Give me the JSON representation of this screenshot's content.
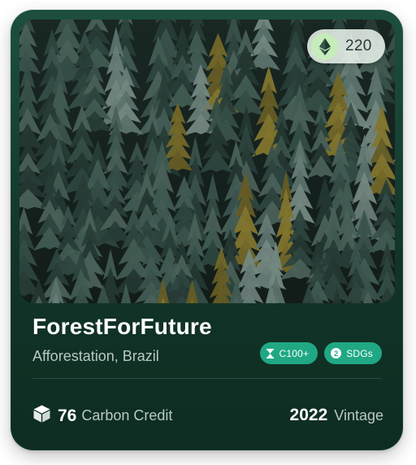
{
  "project": {
    "name": "ForestForFuture",
    "location": "Afforestation, Brazil",
    "image_alt": "Aerial view of dense conifer forest"
  },
  "price": {
    "value": "220",
    "currency_icon": "ethereum-icon"
  },
  "badges": [
    {
      "label": "C100+",
      "icon": "hourglass-icon"
    },
    {
      "label": "SDGs",
      "icon": "number-badge-icon",
      "count": "2"
    }
  ],
  "stats": {
    "credits_value": "76",
    "credits_label": "Carbon Credit",
    "credits_icon": "cube-icon",
    "vintage_year": "2022",
    "vintage_label": "Vintage"
  },
  "colors": {
    "card_bg": "#123528",
    "badge_bg": "#1fa883",
    "price_icon_bg": "#c6ecbb"
  }
}
